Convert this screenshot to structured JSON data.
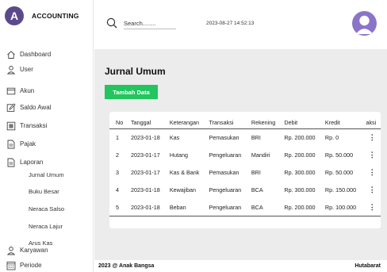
{
  "brand": {
    "logo_letter": "A",
    "name": "ACCOUNTING"
  },
  "sidebar": {
    "items": [
      {
        "label": "Dashboard",
        "icon": "home-icon"
      },
      {
        "label": "User",
        "icon": "user-icon"
      },
      {
        "label": "Akun",
        "icon": "card-icon"
      },
      {
        "label": "Saldo Awal",
        "icon": "edit-icon"
      },
      {
        "label": "Transaksi",
        "icon": "box-icon"
      },
      {
        "label": "Pajak",
        "icon": "document-icon"
      },
      {
        "label": "Laporan",
        "icon": "document-icon"
      },
      {
        "label": "Karyawan",
        "icon": "user-icon"
      },
      {
        "label": "Periode",
        "icon": "calendar-icon"
      }
    ],
    "laporan_sub": [
      "Jurnal Umum",
      "Buku Besar",
      "Neraca Salso",
      "Neraca Lajur",
      "Arus Kas"
    ]
  },
  "search": {
    "placeholder": "Search........"
  },
  "header": {
    "datetime": "2023-08-27 14:52:13"
  },
  "main": {
    "title": "Jurnal Umum",
    "add_button": "Tambah Data"
  },
  "table": {
    "columns": [
      "No",
      "Tanggal",
      "Keterangan",
      "Transaksi",
      "Rekening",
      "Debit",
      "Kredit",
      "aksi"
    ],
    "rows": [
      {
        "no": "1",
        "tanggal": "2023-01-18",
        "keterangan": "Kas",
        "transaksi": "Pemasukan",
        "rekening": "BRI",
        "debit": "Rp. 200.000",
        "kredit": "Rp. 0"
      },
      {
        "no": "2",
        "tanggal": "2023-01-17",
        "keterangan": "Hutang",
        "transaksi": "Pengeluaran",
        "rekening": "Mandiri",
        "debit": "Rp. 200.000",
        "kredit": "Rp. 50.000"
      },
      {
        "no": "3",
        "tanggal": "2023-01-17",
        "keterangan": "Kas & Bank",
        "transaksi": "Pemasukan",
        "rekening": "BRI",
        "debit": "Rp. 300.000",
        "kredit": "Rp. 50.000"
      },
      {
        "no": "4",
        "tanggal": "2023-01-18",
        "keterangan": "Kewajiban",
        "transaksi": "Pengeluaran",
        "rekening": "BCA",
        "debit": "Rp. 300.000",
        "kredit": "Rp. 150.000"
      },
      {
        "no": "5",
        "tanggal": "2023-01-18",
        "keterangan": "Beban",
        "transaksi": "Pengeluaran",
        "rekening": "BCA",
        "debit": "Rp. 200.000",
        "kredit": "Rp. 100.000"
      }
    ],
    "action_glyph": "⋮"
  },
  "footer": {
    "left": "2023 @ Anak Bangsa",
    "right": "Hutabarat"
  },
  "colors": {
    "accent_green": "#22c55e",
    "brand_purple": "#5b4a8b",
    "avatar_purple": "#8b74c8",
    "content_bg": "#ececec"
  }
}
